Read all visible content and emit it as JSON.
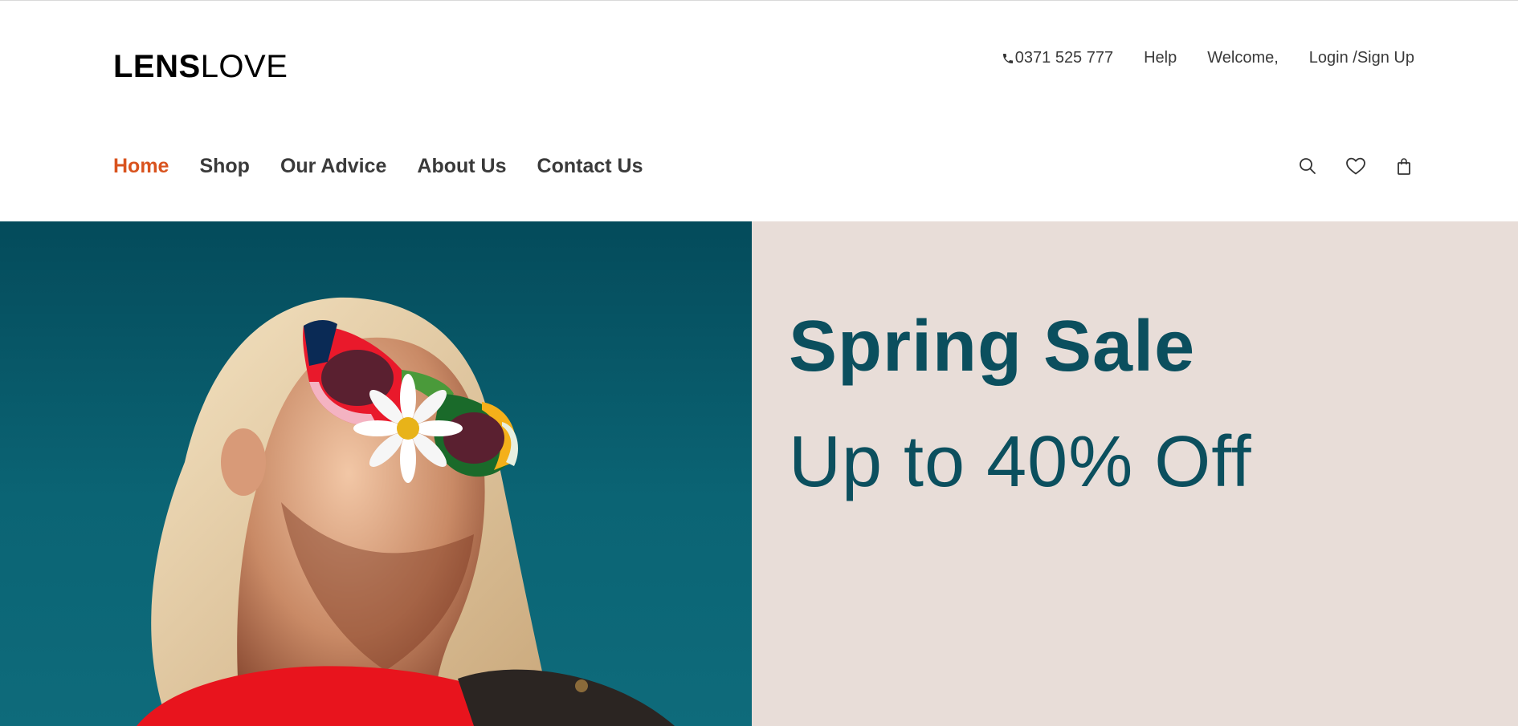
{
  "brand": {
    "logo_bold": "LENS",
    "logo_light": "LOVE"
  },
  "utility": {
    "phone": "0371 525 777",
    "help": "Help",
    "welcome": "Welcome,",
    "login": "Login /Sign Up"
  },
  "nav": {
    "items": [
      {
        "label": "Home",
        "active": true
      },
      {
        "label": "Shop"
      },
      {
        "label": "Our Advice"
      },
      {
        "label": "About Us"
      },
      {
        "label": "Contact Us"
      }
    ]
  },
  "header_icons": [
    "search-icon",
    "heart-icon",
    "shopping-bag-icon"
  ],
  "hero": {
    "title": "Spring Sale",
    "subtitle": "Up to 40% Off",
    "image_subject": "woman-in-colorful-sunglasses-holding-daisy"
  },
  "colors": {
    "accent": "#d9531e",
    "hero_text": "#0b4f5e",
    "hero_right_bg": "#e8ddd8",
    "hero_left_bg": "#0b6474"
  }
}
